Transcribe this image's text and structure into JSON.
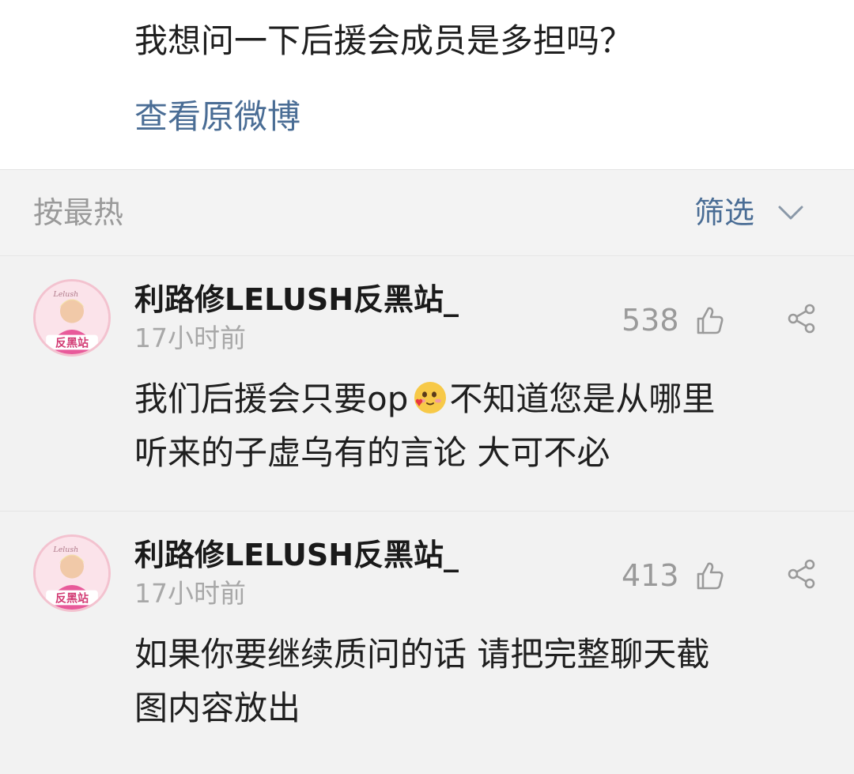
{
  "post": {
    "text": "我想问一下后援会成员是多担吗？",
    "view_original": "查看原微博"
  },
  "sort_bar": {
    "sort_label": "按最热",
    "filter_label": "筛选"
  },
  "comments": [
    {
      "username": "利路修LELUSH反黑站_",
      "time": "17小时前",
      "likes": "538",
      "avatar_text": "反黑站",
      "avatar_sub": "Lelush",
      "text_line1_a": "我们后援会只要op",
      "emoji": "blush-heart-emoji",
      "text_line1_b": "不知道您是从哪里",
      "text_line2": "听来的子虚乌有的言论 大可不必"
    },
    {
      "username": "利路修LELUSH反黑站_",
      "time": "17小时前",
      "likes": "413",
      "avatar_text": "反黑站",
      "avatar_sub": "Lelush",
      "text_line1": "如果你要继续质问的话 请把完整聊天截",
      "text_line2": "图内容放出"
    }
  ],
  "icons": {
    "like": "thumbs-up-icon",
    "share": "share-icon",
    "filter": "chevron-down-icon"
  },
  "colors": {
    "link": "#4a6d95",
    "muted": "#9a9a9a",
    "background": "#f2f2f2"
  }
}
